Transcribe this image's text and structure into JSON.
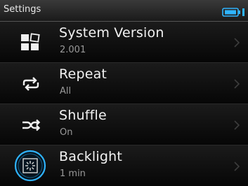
{
  "header": {
    "title": "Settings"
  },
  "menu": {
    "items": [
      {
        "label": "System Version",
        "value": "2.001",
        "icon": "system-version-icon"
      },
      {
        "label": "Repeat",
        "value": "All",
        "icon": "repeat-icon"
      },
      {
        "label": "Shuffle",
        "value": "On",
        "icon": "shuffle-icon"
      },
      {
        "label": "Backlight",
        "value": "1 min",
        "icon": "backlight-icon"
      }
    ]
  },
  "colors": {
    "accent": "#2fb4ff",
    "background": "#000000",
    "secondary_text": "#9a9a9a"
  }
}
